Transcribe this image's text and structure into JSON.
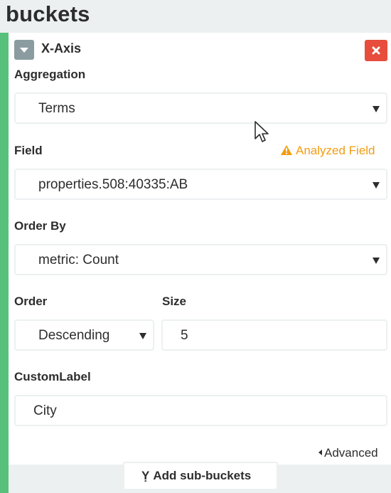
{
  "header": {
    "title": "buckets"
  },
  "aggregation": {
    "title": "X-Axis",
    "icons": {
      "collapse": "caret-down-icon",
      "remove": "close-icon"
    },
    "colors": {
      "accent": "#57c17b",
      "remove": "#e74c3c",
      "collapse": "#8a9ca0",
      "warning": "#f39c12"
    }
  },
  "form": {
    "aggregation_label": "Aggregation",
    "aggregation_value": "Terms",
    "field_label": "Field",
    "field_warning": "Analyzed Field",
    "field_value": "properties.508:40335:AB",
    "order_by_label": "Order By",
    "order_by_value": "metric: Count",
    "order_label": "Order",
    "order_value": "Descending",
    "size_label": "Size",
    "size_value": "5",
    "custom_label_label": "CustomLabel",
    "custom_label_value": "City",
    "advanced_link": "Advanced"
  },
  "footer": {
    "add_sub_buckets_icon": "split-icon",
    "add_sub_buckets_glyph": "Ỵ",
    "add_sub_buckets_label": "Add sub-buckets"
  }
}
